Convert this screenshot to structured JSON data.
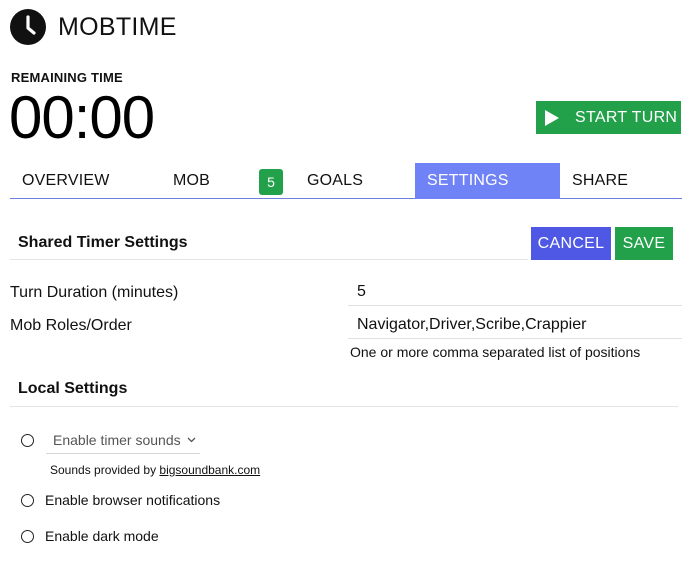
{
  "app": {
    "title": "MOBTIME",
    "logo_icon": "clock-icon"
  },
  "timer": {
    "label": "REMAINING TIME",
    "value": "00:00"
  },
  "start_button": {
    "label": "START TURN",
    "icon": "play-icon",
    "color": "#22a14a"
  },
  "tabs": [
    {
      "label": "OVERVIEW",
      "active": false
    },
    {
      "label": "MOB",
      "active": false,
      "badge": "5"
    },
    {
      "label": "GOALS",
      "active": false
    },
    {
      "label": "SETTINGS",
      "active": true
    },
    {
      "label": "SHARE",
      "active": false
    }
  ],
  "shared_settings": {
    "title": "Shared Timer Settings",
    "cancel_label": "CANCEL",
    "save_label": "SAVE",
    "fields": [
      {
        "label": "Turn Duration (minutes)",
        "value": "5"
      },
      {
        "label": "Mob Roles/Order",
        "value": "Navigator,Driver,Scribe,Crappier",
        "hint": "One or more comma separated list of positions"
      }
    ]
  },
  "local_settings": {
    "title": "Local Settings",
    "timer_sounds": {
      "selected": "Enable timer sounds",
      "checked": false
    },
    "sound_credit": {
      "prefix": "Sounds provided by ",
      "link_text": "bigsoundbank.com"
    },
    "browser_notifications": {
      "label": "Enable browser notifications",
      "checked": false
    },
    "dark_mode": {
      "label": "Enable dark mode",
      "checked": false
    }
  },
  "colors": {
    "accent_blue": "#6f82f6",
    "cancel_blue": "#4f58e4",
    "green": "#22a14a"
  }
}
